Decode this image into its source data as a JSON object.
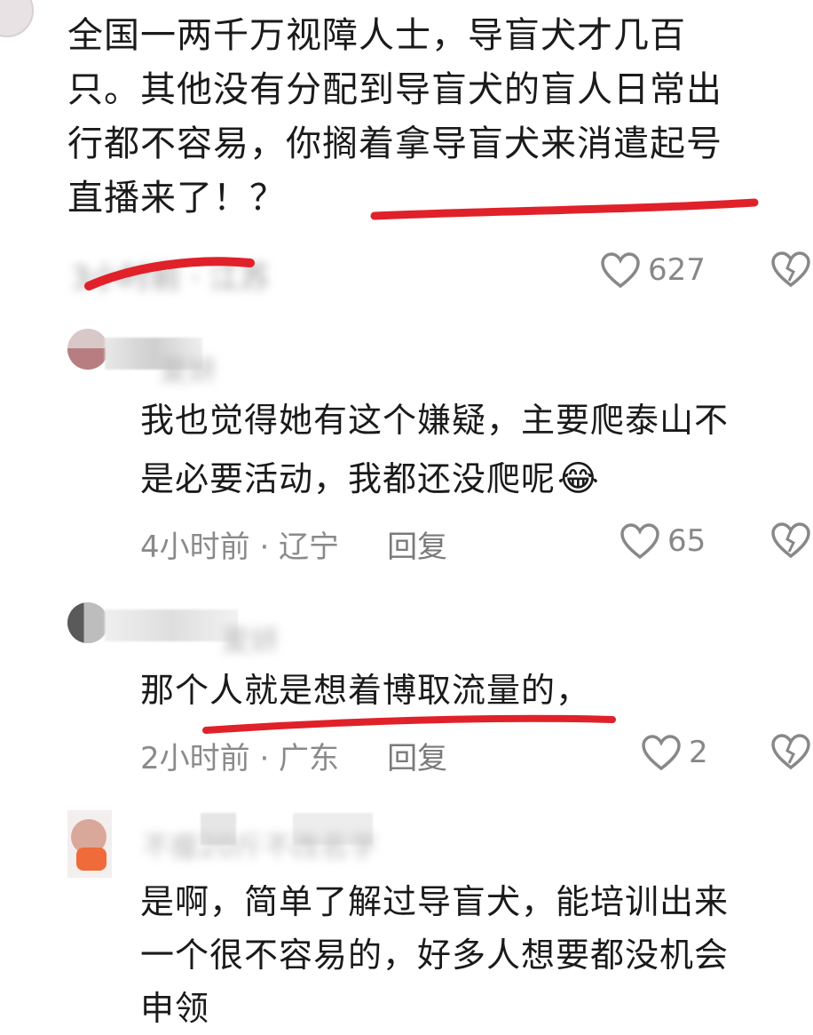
{
  "top_comment": {
    "lines": [
      "全国一两千万视障人士，导盲犬才几百",
      "只。其他没有分配到导盲犬的盲人日常出",
      "行都不容易，你搁着拿导盲犬来消遣起号",
      "直播来了！？"
    ],
    "meta": "3小时前 · 江苏",
    "likes": "627"
  },
  "replies": [
    {
      "username": "夏妍",
      "lines": [
        "我也觉得她有这个嫌疑，主要爬泰山不",
        "是必要活动，我都还没爬呢"
      ],
      "emoji": "😂",
      "time_location": "4小时前 · 辽宁",
      "reply_label": "回复",
      "likes": "65"
    },
    {
      "username": "夏妍",
      "lines": [
        "那个人就是想着博取流量的，"
      ],
      "time_location": "2小时前 · 广东",
      "reply_label": "回复",
      "likes": "2"
    },
    {
      "username": "不瘦20斤不改名字",
      "lines": [
        "是啊，简单了解过导盲犬，能培训出来",
        "一个很不容易的，好多人想要都没机会",
        "申领"
      ]
    }
  ],
  "colors": {
    "underline": "#e0212a",
    "meta": "#9a9a9a",
    "text": "#1a1a1a"
  }
}
